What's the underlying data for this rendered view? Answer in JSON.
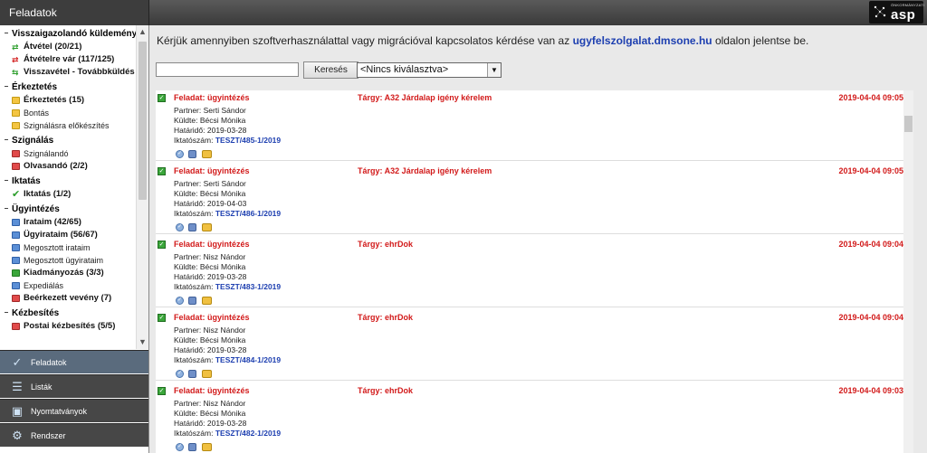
{
  "app": {
    "title": "Feladatok"
  },
  "logo": {
    "small_text": "ÖNKORMÁNYZATI",
    "big_text": "asp"
  },
  "sidebar": {
    "sections": [
      {
        "title": "Visszaigazolandó küldemények",
        "items": [
          {
            "label": "Átvétel (20/21)",
            "bold": true,
            "icon": "green-arrow-icon"
          },
          {
            "label": "Átvételre vár (117/125)",
            "bold": true,
            "icon": "red-arrow-icon"
          },
          {
            "label": "Visszavétel - Továbbküldés",
            "bold": true,
            "icon": "green-arrow-icon"
          }
        ]
      },
      {
        "title": "Érkeztetés",
        "items": [
          {
            "label": "Érkeztetés (15)",
            "bold": true,
            "icon": "yellow-folder-icon"
          },
          {
            "label": "Bontás",
            "bold": false,
            "icon": "yellow-folder-icon"
          },
          {
            "label": "Szignálásra előkészítés",
            "bold": false,
            "icon": "yellow-folder-icon"
          }
        ]
      },
      {
        "title": "Szignálás",
        "items": [
          {
            "label": "Szignálandó",
            "bold": false,
            "icon": "red-task-icon"
          },
          {
            "label": "Olvasandó (2/2)",
            "bold": true,
            "icon": "red-task-icon"
          }
        ]
      },
      {
        "title": "Iktatás",
        "items": [
          {
            "label": "Iktatás (1/2)",
            "bold": true,
            "icon": "green-check-icon"
          }
        ]
      },
      {
        "title": "Ügyintézés",
        "items": [
          {
            "label": "Irataim (42/65)",
            "bold": true,
            "icon": "blue-doc-icon"
          },
          {
            "label": "Ügyirataim (56/67)",
            "bold": true,
            "icon": "blue-doc-icon"
          },
          {
            "label": "Megosztott irataim",
            "bold": false,
            "icon": "blue-doc-icon"
          },
          {
            "label": "Megosztott ügyirataim",
            "bold": false,
            "icon": "blue-doc-icon"
          },
          {
            "label": "Kiadmányozás (3/3)",
            "bold": true,
            "icon": "green-sign-icon"
          },
          {
            "label": "Expediálás",
            "bold": false,
            "icon": "blue-send-icon"
          },
          {
            "label": "Beérkezett vevény (7)",
            "bold": true,
            "icon": "red-receipt-icon"
          }
        ]
      },
      {
        "title": "Kézbesítés",
        "items": [
          {
            "label": "Postai kézbesítés (5/5)",
            "bold": true,
            "icon": "red-mail-icon"
          }
        ]
      }
    ]
  },
  "nav": [
    {
      "label": "Feladatok",
      "icon": "checkmark-icon",
      "active": true
    },
    {
      "label": "Listák",
      "icon": "list-icon",
      "active": false
    },
    {
      "label": "Nyomtatványok",
      "icon": "form-icon",
      "active": false
    },
    {
      "label": "Rendszer",
      "icon": "system-icon",
      "active": false
    }
  ],
  "notice": {
    "text_before": "Kérjük amennyiben szoftverhasználattal vagy migrációval kapcsolatos kérdése van az",
    "link": "ugyfelszolgalat.dmsone.hu",
    "text_after": "oldalon jelentse be."
  },
  "search": {
    "value": "",
    "button_label": "Keresés"
  },
  "filter": {
    "selected": "<Nincs kiválasztva>"
  },
  "labels": {
    "partner": "Partner:",
    "kuldte": "Küldte:",
    "hatarido": "Határidő:",
    "iktatoszam": "Iktatószám:"
  },
  "tasks": [
    {
      "feladat": "Feladat: ügyintézés",
      "targy": "Tárgy: A32 Járdalap igény kérelem",
      "date": "2019-04-04 09:05",
      "partner": "Serti Sándor",
      "kuldte": "Bécsi Mónika",
      "hatarido": "2019-03-28",
      "iktatoszam": "TESZT/485-1/2019"
    },
    {
      "feladat": "Feladat: ügyintézés",
      "targy": "Tárgy: A32 Járdalap igény kérelem",
      "date": "2019-04-04 09:05",
      "partner": "Serti Sándor",
      "kuldte": "Bécsi Mónika",
      "hatarido": "2019-04-03",
      "iktatoszam": "TESZT/486-1/2019"
    },
    {
      "feladat": "Feladat: ügyintézés",
      "targy": "Tárgy: ehrDok",
      "date": "2019-04-04 09:04",
      "partner": "Nisz Nándor",
      "kuldte": "Bécsi Mónika",
      "hatarido": "2019-03-28",
      "iktatoszam": "TESZT/483-1/2019"
    },
    {
      "feladat": "Feladat: ügyintézés",
      "targy": "Tárgy: ehrDok",
      "date": "2019-04-04 09:04",
      "partner": "Nisz Nándor",
      "kuldte": "Bécsi Mónika",
      "hatarido": "2019-03-28",
      "iktatoszam": "TESZT/484-1/2019"
    },
    {
      "feladat": "Feladat: ügyintézés",
      "targy": "Tárgy: ehrDok",
      "date": "2019-04-04 09:03",
      "partner": "Nisz Nándor",
      "kuldte": "Bécsi Mónika",
      "hatarido": "2019-03-28",
      "iktatoszam": "TESZT/482-1/2019"
    }
  ],
  "colors": {
    "accent_red": "#d21a1a",
    "link_blue": "#1d3fb0",
    "nav_bg": "#474747",
    "nav_active": "#5a6b7d"
  }
}
